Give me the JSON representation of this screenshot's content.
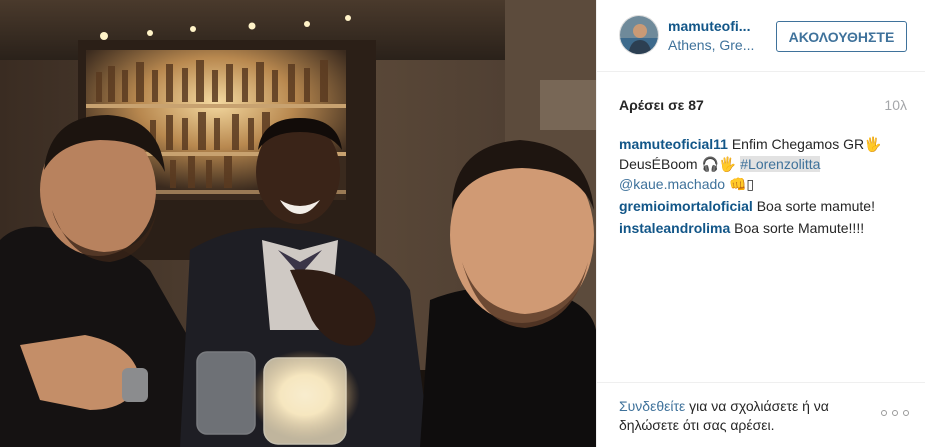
{
  "header": {
    "username": "mamuteoficial11",
    "username_display": "mamuteofi...",
    "location": "Athens, Gre...",
    "follow_label": "ΑΚΟΛΟΥΘΗΣΤΕ"
  },
  "stats": {
    "likes": "Αρέσει σε 87",
    "time_ago": "10λ"
  },
  "comments": [
    {
      "author": "mamuteoficial11",
      "text": "Enfim Chegamos GR🖐 DeusÉBoom 🎧🖐",
      "hashtag": "#Lorenzolitta",
      "mention": "@kaue.machado",
      "trailing": "👊▯"
    },
    {
      "author": "gremioimortaloficial",
      "text": "Boa sorte mamute!"
    },
    {
      "author": "instaleandrolima",
      "text": "Boa sorte Mamute!!!!"
    }
  ],
  "footer": {
    "login_link": "Συνδεθείτε",
    "login_rest": "για να σχολιάσετε ή να δηλώσετε ότι σας αρέσει.",
    "more_icon": "ellipsis-icon"
  },
  "colors": {
    "username_blue": "#125688",
    "link_blue": "#3f729b",
    "muted_gray": "#a5a7aa",
    "border": "#efefef"
  }
}
